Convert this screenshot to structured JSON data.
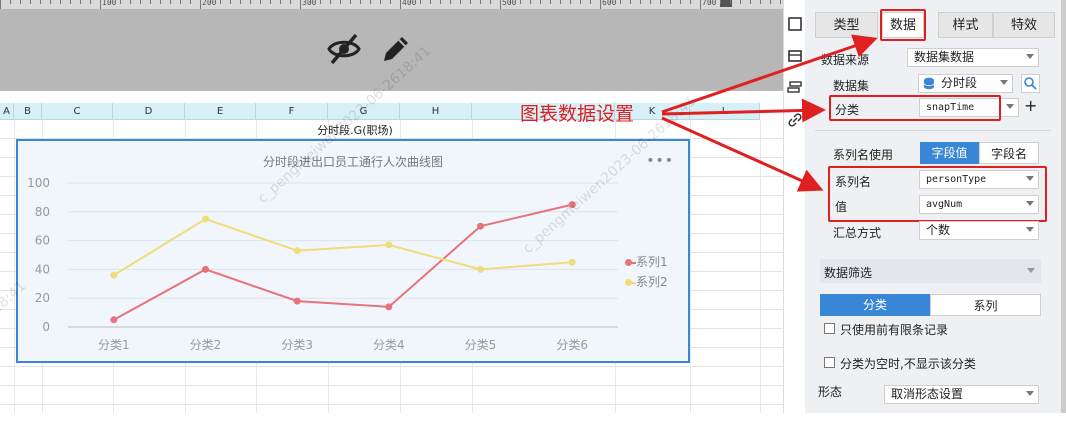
{
  "ruler": {
    "labels": [
      "100",
      "200",
      "300",
      "400",
      "500",
      "600",
      "700"
    ]
  },
  "spreadsheet": {
    "columns": [
      "A",
      "B",
      "C",
      "D",
      "E",
      "F",
      "G",
      "H",
      "I",
      "K",
      "L"
    ],
    "cell_title": "分时段.G(职场)"
  },
  "chart_data": {
    "type": "line",
    "title": "分时段进出口员工通行人次曲线图",
    "categories": [
      "分类1",
      "分类2",
      "分类3",
      "分类4",
      "分类5",
      "分类6"
    ],
    "ylim": [
      0,
      100
    ],
    "yticks": [
      "0",
      "20",
      "40",
      "60",
      "80",
      "100"
    ],
    "series": [
      {
        "name": "系列1",
        "color": "#e8737b",
        "values": [
          5,
          40,
          18,
          14,
          70,
          85
        ]
      },
      {
        "name": "系列2",
        "color": "#f0dc7a",
        "values": [
          36,
          75,
          53,
          57,
          40,
          45
        ]
      }
    ],
    "legend": "right",
    "grid": true
  },
  "annotation": {
    "text": "图表数据设置"
  },
  "panel": {
    "tabs": [
      "类型",
      "数据",
      "样式",
      "特效"
    ],
    "active_tab": "数据",
    "data_source_label": "数据来源",
    "data_source_value": "数据集数据",
    "dataset_label": "数据集",
    "dataset_value": "分时段",
    "category_label": "分类",
    "category_value": "snapTime",
    "series_name_use_label": "系列名使用",
    "series_name_use_options": [
      "字段值",
      "字段名"
    ],
    "series_name_label": "系列名",
    "series_name_value": "personType",
    "value_label": "值",
    "value_value": "avgNum",
    "summary_label": "汇总方式",
    "summary_value": "个数",
    "filter_label": "数据筛选",
    "filter_tabs": [
      "分类",
      "系列"
    ],
    "only_limited_label": "只使用前有限条记录",
    "hide_empty_label": "分类为空时,不显示该分类",
    "shape_label": "形态",
    "shape_value": "取消形态设置"
  },
  "watermark": "c_pengmeiwen2023-06-2618:41",
  "colors": {
    "accent": "#3a86d6",
    "highlight": "#e02020"
  }
}
